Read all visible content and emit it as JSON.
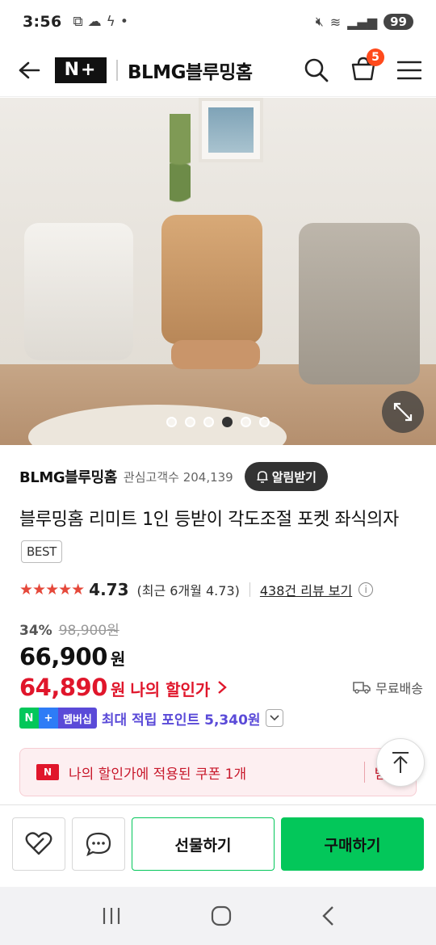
{
  "status_bar": {
    "time": "3:56",
    "icons": [
      "screenshot-icon",
      "cloud-icon",
      "flash-icon",
      "dot-icon"
    ],
    "right_icons": [
      "mute-icon",
      "wifi-icon",
      "signal-icon"
    ],
    "battery": "99"
  },
  "header": {
    "logo": "N+",
    "title": "BLMG블루밍홈",
    "cart_count": "5"
  },
  "hero": {
    "dots_total": 6,
    "dots_active": 4
  },
  "store": {
    "name": "BLMG블루밍홈",
    "followers_label": "관심고객수 204,139",
    "follow_button": "알림받기"
  },
  "product": {
    "title": "블루밍홈 리미트 1인 등받이 각도조절 포켓 좌식의자",
    "badge": "BEST",
    "rating_stars": "★★★★★",
    "rating_value": "4.73",
    "rating_recent": "(최근 6개월 4.73)",
    "review_link": "438건 리뷰 보기"
  },
  "price": {
    "discount_rate": "34%",
    "original_price": "98,900원",
    "sale_price": "66,900",
    "currency": "원",
    "my_price": "64,890",
    "my_price_currency": "원",
    "my_price_label": "나의 할인가",
    "shipping": "무료배송"
  },
  "points": {
    "badge_n": "N",
    "badge_plus": "+",
    "badge_membership": "멤버십",
    "text": "최대 적립 포인트 5,340원"
  },
  "coupon": {
    "icon_label": "N",
    "text": "나의 할인가에 적용된 쿠폰 1개",
    "action": "받기"
  },
  "bottom_bar": {
    "gift_label": "선물하기",
    "buy_label": "구매하기"
  },
  "colors": {
    "accent_green": "#03c75a",
    "discount_red": "#e0162b",
    "point_purple": "#5a4ad8",
    "cart_badge": "#ff4a1c"
  }
}
